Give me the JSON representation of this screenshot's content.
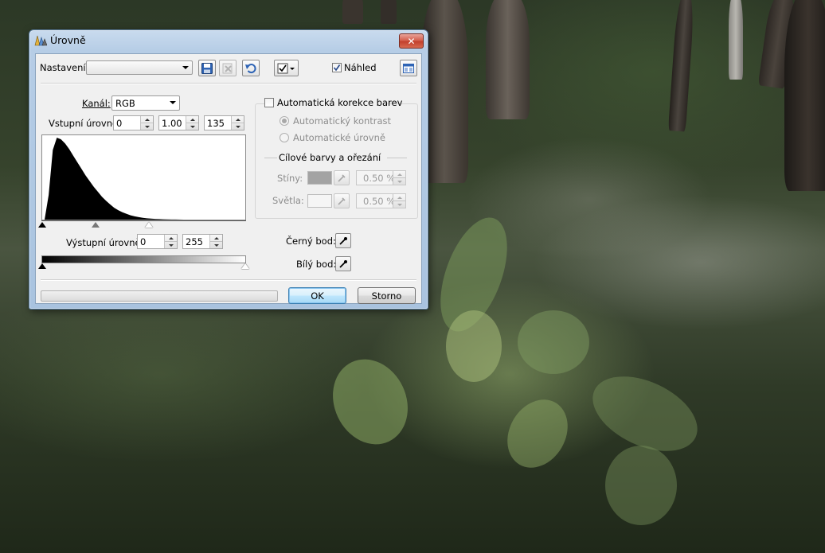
{
  "window": {
    "title": "Úrovně",
    "close_glyph": "✕"
  },
  "toolbar": {
    "preset_label": "Nastavení:",
    "preset_value": "",
    "preview_label": "Náhled",
    "preview_checked": true
  },
  "levels": {
    "channel_label": "Kanál:",
    "channel_value": "RGB",
    "input_label": "Vstupní úrovně:",
    "input_black": "0",
    "input_gamma": "1.00",
    "input_white": "135",
    "output_label": "Výstupní úrovně:",
    "output_black": "0",
    "output_white": "255",
    "histogram": [
      0,
      0.3,
      0.85,
      1.0,
      0.98,
      0.93,
      0.86,
      0.78,
      0.7,
      0.62,
      0.54,
      0.47,
      0.4,
      0.34,
      0.28,
      0.23,
      0.185,
      0.145,
      0.115,
      0.09,
      0.07,
      0.052,
      0.04,
      0.03,
      0.022,
      0.016,
      0.012,
      0.009,
      0.007,
      0.005,
      0.004,
      0.003,
      0.002,
      0.001,
      0,
      0,
      0,
      0,
      0,
      0,
      0,
      0,
      0,
      0,
      0,
      0,
      0,
      0,
      0,
      0
    ]
  },
  "auto": {
    "checkbox_label": "Automatická korekce barev",
    "radio_contrast": "Automatický kontrast",
    "radio_levels": "Automatické úrovně",
    "target_group_label": "Cílové barvy a ořezání",
    "shadows_label": "Stíny:",
    "shadows_value": "0.50 %",
    "highlights_label": "Světla:",
    "highlights_value": "0.50 %"
  },
  "points": {
    "black_label": "Černý bod:",
    "white_label": "Bílý bod:"
  },
  "buttons": {
    "ok": "OK",
    "cancel": "Storno"
  },
  "colors": {
    "shadows_swatch": "#a3a3a3",
    "highlights_swatch": "#f5f5f5",
    "histogram_fill": "#000000"
  }
}
